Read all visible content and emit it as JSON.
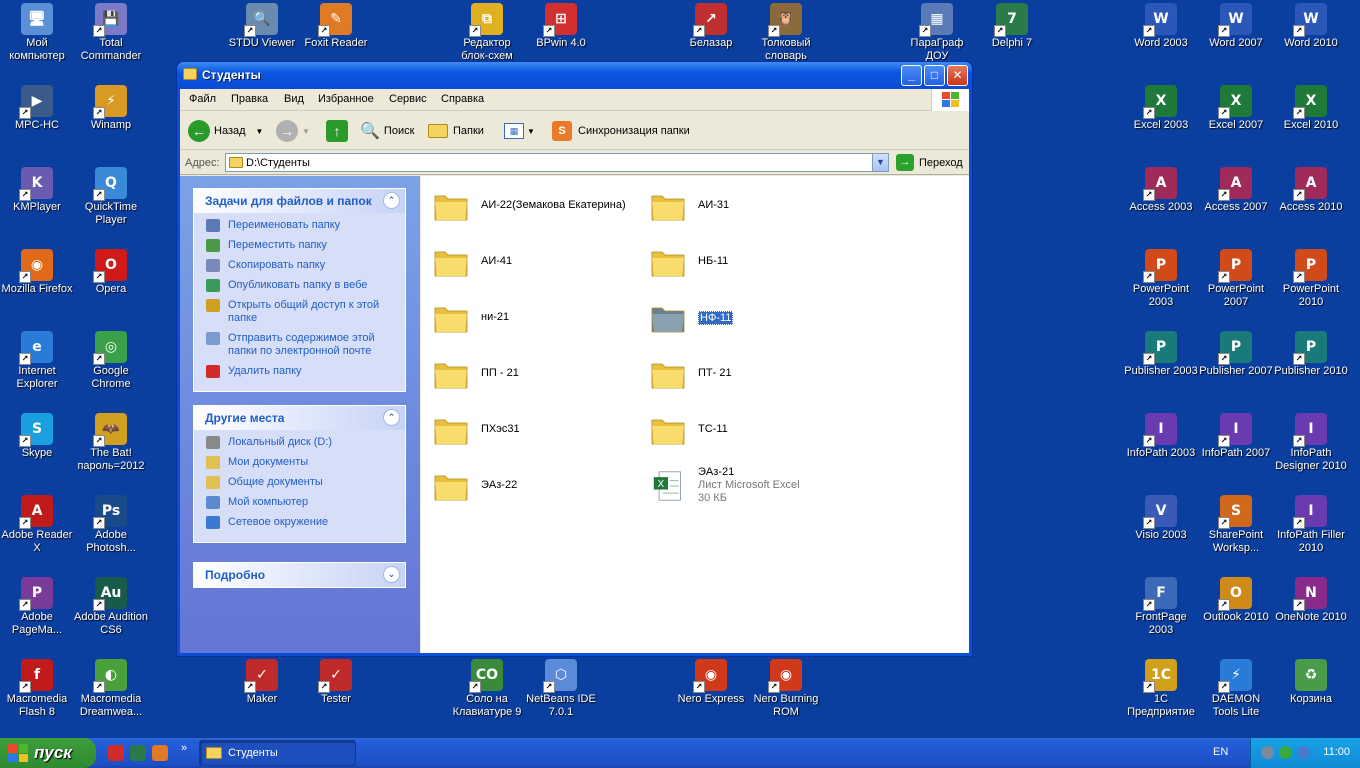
{
  "desktop": {
    "icons": [
      {
        "label": "Мой компьютер",
        "color": "#5b8fd6",
        "glyph": "🖥"
      },
      {
        "label": "Total Commander",
        "color": "#7c7ac8",
        "glyph": "💾"
      },
      {
        "label": "STDU Viewer",
        "color": "#6a8bb0",
        "glyph": "🔍"
      },
      {
        "label": "Foxit Reader",
        "color": "#e07a24",
        "glyph": "✎"
      },
      {
        "label": "Редактор блок-схем",
        "color": "#e0b020",
        "glyph": "⧉"
      },
      {
        "label": "BPwin 4.0",
        "color": "#d23030",
        "glyph": "⊞"
      },
      {
        "label": "Белазар",
        "color": "#c03030",
        "glyph": "↗"
      },
      {
        "label": "Толковый словарь",
        "color": "#8a6a3a",
        "glyph": "🦉"
      },
      {
        "label": "ПараГраф ДОУ",
        "color": "#5a7ab8",
        "glyph": "▦"
      },
      {
        "label": "Delphi 7",
        "color": "#2a7a4a",
        "glyph": "7"
      },
      {
        "label": "Word 2003",
        "color": "#2a57b8",
        "glyph": "W"
      },
      {
        "label": "Word 2007",
        "color": "#2a57b8",
        "glyph": "W"
      },
      {
        "label": "Word 2010",
        "color": "#2a57b8",
        "glyph": "W"
      },
      {
        "label": "MPC-HC",
        "color": "#3a5a8a",
        "glyph": "▶"
      },
      {
        "label": "Winamp",
        "color": "#d89a20",
        "glyph": "⚡"
      },
      {
        "label": "Excel 2003",
        "color": "#1f7a3a",
        "glyph": "X"
      },
      {
        "label": "Excel 2007",
        "color": "#1f7a3a",
        "glyph": "X"
      },
      {
        "label": "Excel 2010",
        "color": "#1f7a3a",
        "glyph": "X"
      },
      {
        "label": "KMPlayer",
        "color": "#6a5ab0",
        "glyph": "K"
      },
      {
        "label": "QuickTime Player",
        "color": "#3a8ad8",
        "glyph": "Q"
      },
      {
        "label": "Access 2003",
        "color": "#a02a5a",
        "glyph": "A"
      },
      {
        "label": "Access 2007",
        "color": "#a02a5a",
        "glyph": "A"
      },
      {
        "label": "Access 2010",
        "color": "#a02a5a",
        "glyph": "A"
      },
      {
        "label": "Mozilla Firefox",
        "color": "#e06a1a",
        "glyph": "◉"
      },
      {
        "label": "Opera",
        "color": "#d01a1a",
        "glyph": "O"
      },
      {
        "label": "PowerPoint 2003",
        "color": "#d04a1a",
        "glyph": "P"
      },
      {
        "label": "PowerPoint 2007",
        "color": "#d04a1a",
        "glyph": "P"
      },
      {
        "label": "PowerPoint 2010",
        "color": "#d04a1a",
        "glyph": "P"
      },
      {
        "label": "Internet Explorer",
        "color": "#2a7ad8",
        "glyph": "e"
      },
      {
        "label": "Google Chrome",
        "color": "#3aa04a",
        "glyph": "◎"
      },
      {
        "label": "Publisher 2003",
        "color": "#1a7a7a",
        "glyph": "P"
      },
      {
        "label": "Publisher 2007",
        "color": "#1a7a7a",
        "glyph": "P"
      },
      {
        "label": "Publisher 2010",
        "color": "#1a7a7a",
        "glyph": "P"
      },
      {
        "label": "Skype",
        "color": "#1aa0e0",
        "glyph": "S"
      },
      {
        "label": "The Bat! пароль=2012",
        "color": "#d0a020",
        "glyph": "🦇"
      },
      {
        "label": "InfoPath 2003",
        "color": "#6a3ab0",
        "glyph": "I"
      },
      {
        "label": "InfoPath 2007",
        "color": "#6a3ab0",
        "glyph": "I"
      },
      {
        "label": "InfoPath Designer 2010",
        "color": "#6a3ab0",
        "glyph": "I"
      },
      {
        "label": "Adobe Reader X",
        "color": "#c01a1a",
        "glyph": "A"
      },
      {
        "label": "Adobe Photosh...",
        "color": "#1a4a8a",
        "glyph": "Ps"
      },
      {
        "label": "Visio 2003",
        "color": "#3a5ab8",
        "glyph": "V"
      },
      {
        "label": "SharePoint Worksp...",
        "color": "#d06a1a",
        "glyph": "S"
      },
      {
        "label": "InfoPath Filler 2010",
        "color": "#6a3ab0",
        "glyph": "I"
      },
      {
        "label": "Adobe PageMa...",
        "color": "#7a3a9a",
        "glyph": "P"
      },
      {
        "label": "Adobe Audition CS6",
        "color": "#1a5a4a",
        "glyph": "Au"
      },
      {
        "label": "FrontPage 2003",
        "color": "#3a6ab8",
        "glyph": "F"
      },
      {
        "label": "Outlook 2010",
        "color": "#d08a1a",
        "glyph": "O"
      },
      {
        "label": "OneNote 2010",
        "color": "#8a2a8a",
        "glyph": "N"
      },
      {
        "label": "Macromedia Flash 8",
        "color": "#c01a1a",
        "glyph": "f"
      },
      {
        "label": "Macromedia Dreamwea...",
        "color": "#4aa03a",
        "glyph": "◐"
      },
      {
        "label": "Maker",
        "color": "#c02a2a",
        "glyph": "✓"
      },
      {
        "label": "Tester",
        "color": "#c02a2a",
        "glyph": "✓"
      },
      {
        "label": "Соло на Клавиатуре 9",
        "color": "#3a8a3a",
        "glyph": "СО"
      },
      {
        "label": "NetBeans IDE 7.0.1",
        "color": "#5a8ad8",
        "glyph": "⬡"
      },
      {
        "label": "Nero Express",
        "color": "#d03a1a",
        "glyph": "◉"
      },
      {
        "label": "Nero Burning ROM",
        "color": "#d03a1a",
        "glyph": "◉"
      },
      {
        "label": "1С Предприятие",
        "color": "#d0a01a",
        "glyph": "1С"
      },
      {
        "label": "DAEMON Tools Lite",
        "color": "#2a7ad8",
        "glyph": "⚡"
      },
      {
        "label": "Корзина",
        "color": "#4a9a4a",
        "glyph": "♻"
      }
    ]
  },
  "window": {
    "title": "Студенты",
    "controls": {
      "minimize": "_",
      "maximize": "□",
      "close": "✕"
    },
    "menu": [
      "Файл",
      "Правка",
      "Вид",
      "Избранное",
      "Сервис",
      "Справка"
    ],
    "toolbar": {
      "back": "Назад",
      "search": "Поиск",
      "folders": "Папки",
      "sync": "Синхронизация папки"
    },
    "address": {
      "label": "Адрес:",
      "value": "D:\\Студенты",
      "go": "Переход"
    },
    "tasks": {
      "title": "Задачи для файлов и папок",
      "items": [
        {
          "label": "Переименовать папку",
          "color": "#5a7ab8"
        },
        {
          "label": "Переместить папку",
          "color": "#4a9a4a"
        },
        {
          "label": "Скопировать папку",
          "color": "#7a8ab8"
        },
        {
          "label": "Опубликовать папку в вебе",
          "color": "#3a9a5a"
        },
        {
          "label": "Открыть общий доступ к этой папке",
          "color": "#d0a020"
        },
        {
          "label": "Отправить содержимое этой папки по электронной почте",
          "color": "#7a9ad0"
        },
        {
          "label": "Удалить папку",
          "color": "#d02a2a"
        }
      ]
    },
    "places": {
      "title": "Другие места",
      "items": [
        {
          "label": "Локальный диск (D:)",
          "color": "#8a8a8a"
        },
        {
          "label": "Мои документы",
          "color": "#e0c050"
        },
        {
          "label": "Общие документы",
          "color": "#e0c050"
        },
        {
          "label": "Мой компьютер",
          "color": "#5a8ad0"
        },
        {
          "label": "Сетевое окружение",
          "color": "#3a7ad0"
        }
      ]
    },
    "details": {
      "title": "Подробно"
    },
    "files": [
      {
        "name": "АИ-22(Земакова Екатерина)",
        "type": "folder"
      },
      {
        "name": "АИ-31",
        "type": "folder"
      },
      {
        "name": "АИ-41",
        "type": "folder"
      },
      {
        "name": "НБ-11",
        "type": "folder"
      },
      {
        "name": "ни-21",
        "type": "folder"
      },
      {
        "name": "НФ-11",
        "type": "folder-selected"
      },
      {
        "name": "ПП - 21",
        "type": "folder"
      },
      {
        "name": "ПТ- 21",
        "type": "folder"
      },
      {
        "name": "ПХэс31",
        "type": "folder"
      },
      {
        "name": "ТС-11",
        "type": "folder"
      },
      {
        "name": "ЭАз-22",
        "type": "folder"
      },
      {
        "name": "ЭАз-21",
        "type": "excel",
        "sub1": "Лист Microsoft Excel",
        "sub2": "30 КБ"
      }
    ]
  },
  "taskbar": {
    "start": "пуск",
    "task": "Студенты",
    "lang": "EN",
    "clock": "11:00"
  }
}
